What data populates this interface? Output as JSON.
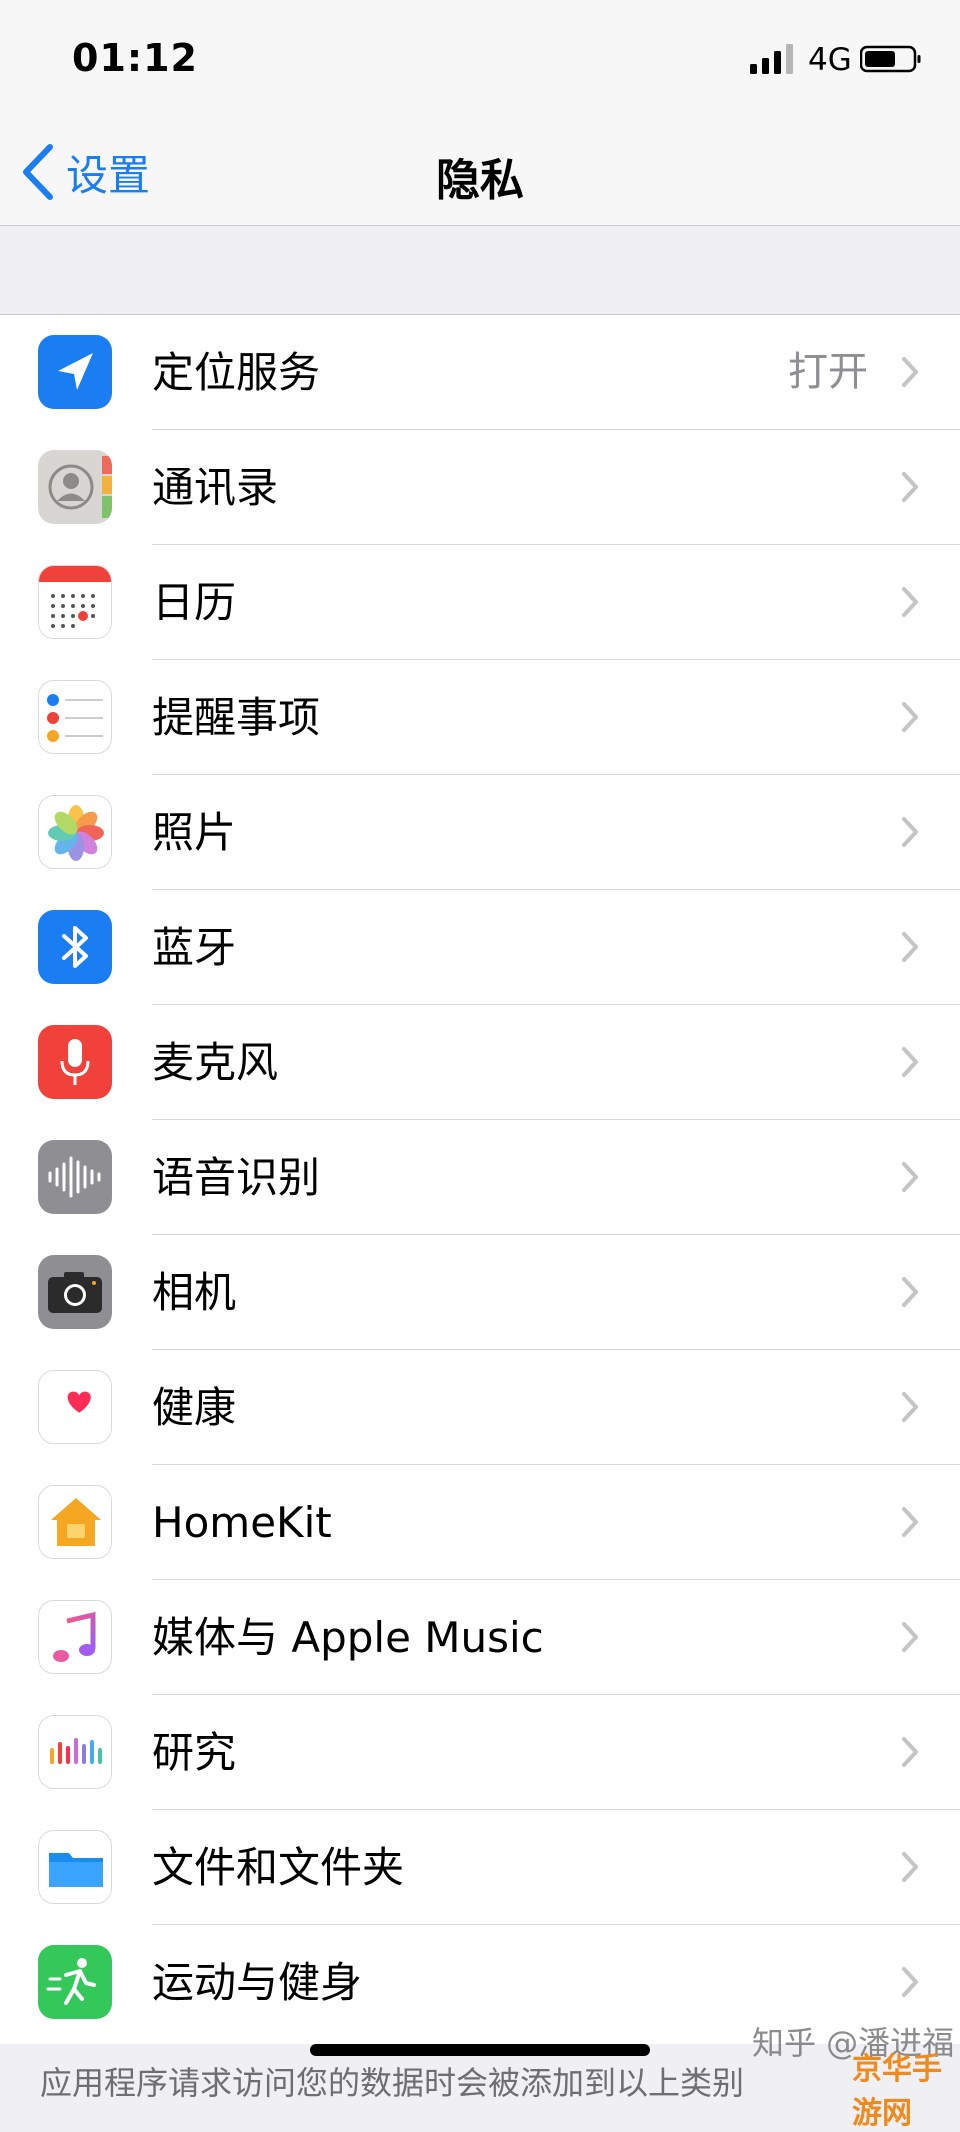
{
  "status_bar": {
    "time": "01:12",
    "network": "4G"
  },
  "nav": {
    "back_label": "设置",
    "title": "隐私"
  },
  "items": [
    {
      "label": "定位服务",
      "value": "打开",
      "icon": "location-icon"
    },
    {
      "label": "通讯录",
      "icon": "contacts-icon"
    },
    {
      "label": "日历",
      "icon": "calendar-icon"
    },
    {
      "label": "提醒事项",
      "icon": "reminders-icon"
    },
    {
      "label": "照片",
      "icon": "photos-icon"
    },
    {
      "label": "蓝牙",
      "icon": "bluetooth-icon"
    },
    {
      "label": "麦克风",
      "icon": "microphone-icon"
    },
    {
      "label": "语音识别",
      "icon": "speech-recognition-icon"
    },
    {
      "label": "相机",
      "icon": "camera-icon"
    },
    {
      "label": "健康",
      "icon": "health-icon"
    },
    {
      "label": "HomeKit",
      "icon": "homekit-icon"
    },
    {
      "label": "媒体与 Apple Music",
      "icon": "music-icon"
    },
    {
      "label": "研究",
      "icon": "research-icon"
    },
    {
      "label": "文件和文件夹",
      "icon": "folder-icon"
    },
    {
      "label": "运动与健身",
      "icon": "fitness-icon"
    }
  ],
  "footer": {
    "text": "应用程序请求访问您的数据时会被添加到以上类别"
  },
  "watermark": {
    "text": "知乎 @潘进福",
    "logo_text": "京华手游网"
  },
  "colors": {
    "accent": "#1a7ef2",
    "background": "#efeff4",
    "separator": "#d6d6db",
    "secondary_text": "#8e8e93"
  }
}
